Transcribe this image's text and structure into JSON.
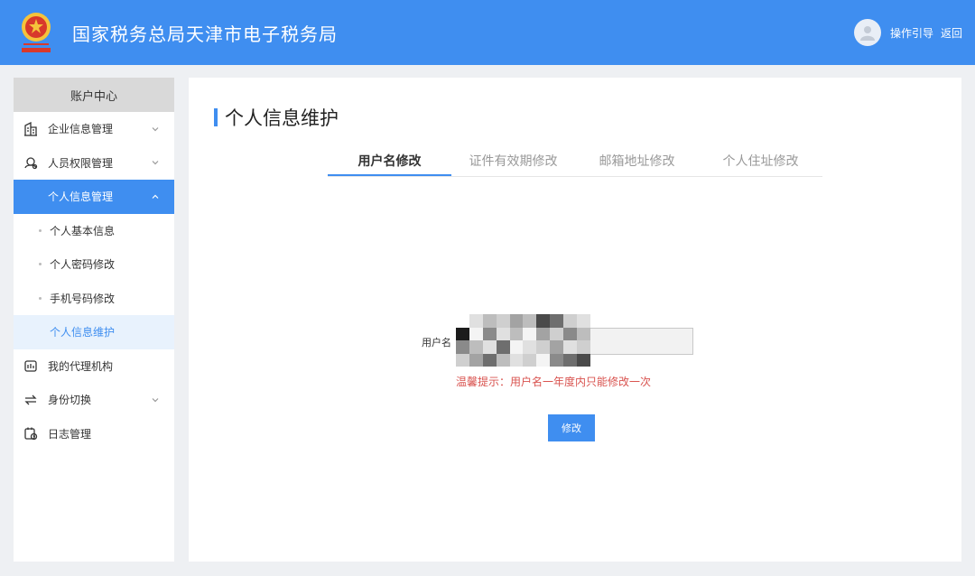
{
  "header": {
    "app_title": "国家税务总局天津市电子税务局",
    "guide_label": "操作引导",
    "back_label": "返回"
  },
  "sidebar": {
    "title": "账户中心",
    "items": [
      {
        "label": "企业信息管理",
        "icon": "building-icon"
      },
      {
        "label": "人员权限管理",
        "icon": "user-lock-icon"
      },
      {
        "label": "个人信息管理",
        "icon": "none"
      },
      {
        "label": "个人基本信息"
      },
      {
        "label": "个人密码修改"
      },
      {
        "label": "手机号码修改"
      },
      {
        "label": "个人信息维护"
      },
      {
        "label": "我的代理机构",
        "icon": "agency-icon"
      },
      {
        "label": "身份切换",
        "icon": "switch-icon"
      },
      {
        "label": "日志管理",
        "icon": "log-icon"
      }
    ]
  },
  "main": {
    "page_title": "个人信息维护",
    "tabs": [
      {
        "label": "用户名修改"
      },
      {
        "label": "证件有效期修改"
      },
      {
        "label": "邮箱地址修改"
      },
      {
        "label": "个人住址修改"
      }
    ],
    "form": {
      "username_label": "用户名",
      "tip": "温馨提示：用户名一年度内只能修改一次",
      "submit_label": "修改"
    }
  },
  "colors": {
    "primary": "#3f8ef0",
    "tip": "#d9534f"
  }
}
